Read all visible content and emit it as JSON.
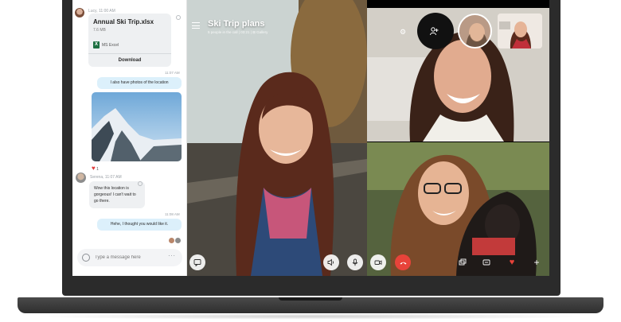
{
  "chat": {
    "sender_name": "Lucy",
    "sender_time": "11:00 AM",
    "file": {
      "name": "Annual Ski Trip.xlsx",
      "size": "7.6 MB",
      "type": "MS Excel",
      "download_label": "Download"
    },
    "time_1": "11:07 AM",
    "msg_photos": "I also have photos of the location",
    "reaction_count": "1",
    "serena_name": "Serena",
    "serena_time": "11:07 AM",
    "serena_msg": "Wow this location is gorgeous! I can't wait to go there.",
    "time_2": "11:08 AM",
    "msg_reply": "Hehe, I thought you would like it.",
    "composer_placeholder": "Type a message here",
    "more_label": "···"
  },
  "call": {
    "title": "Ski Trip plans",
    "subtitle": "5 people in the call | 03:21 | ⊞ Gallery"
  },
  "icons": {
    "chat": "chat-icon",
    "speaker": "speaker-icon",
    "mic": "microphone-icon",
    "camera": "video-camera-icon",
    "hangup": "end-call-icon",
    "share": "share-screen-icon",
    "caption": "captions-icon",
    "heart": "heart-icon",
    "add": "plus-icon",
    "settings": "gear-icon",
    "add_person": "add-person-icon",
    "menu": "hamburger-menu-icon"
  },
  "colors": {
    "end_call": "#e8433a",
    "bubble_out": "#dcf0fb",
    "bubble_in": "#eef0f2",
    "excel_green": "#1d6f42"
  }
}
